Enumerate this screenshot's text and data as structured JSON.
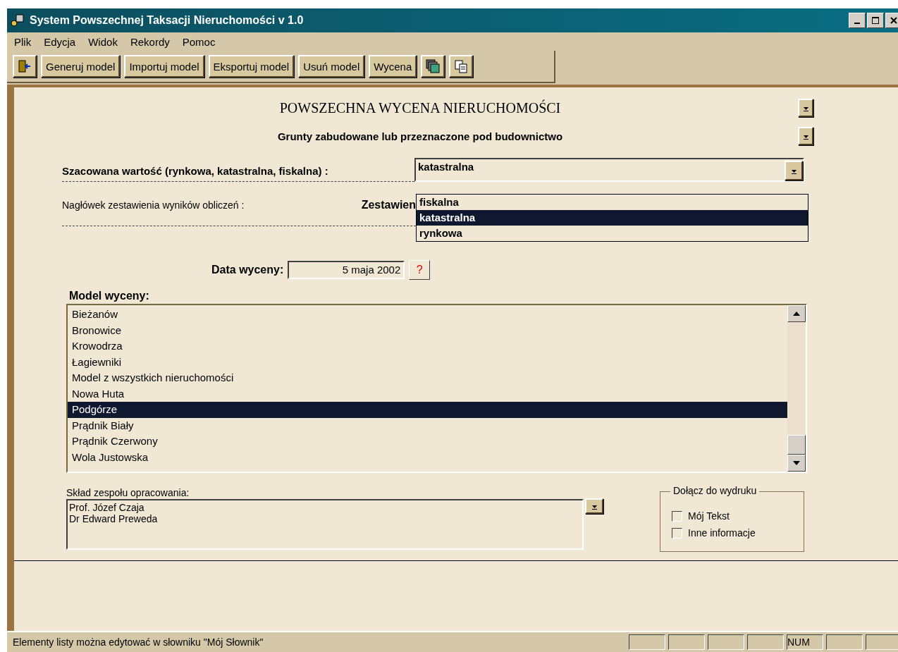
{
  "window": {
    "title": "System Powszechnej Taksacji Nieruchomości  v 1.0"
  },
  "menu": [
    "Plik",
    "Edycja",
    "Widok",
    "Rekordy",
    "Pomoc"
  ],
  "toolbar": [
    {
      "kind": "exit"
    },
    {
      "kind": "text",
      "label": "Generuj model"
    },
    {
      "kind": "text",
      "label": "Importuj model"
    },
    {
      "kind": "text",
      "label": "Eksportuj model"
    },
    {
      "kind": "text",
      "label": "Usuń model"
    },
    {
      "kind": "text",
      "label": "Wycena"
    },
    {
      "kind": "pages"
    },
    {
      "kind": "copy"
    }
  ],
  "heading": "POWSZECHNA WYCENA NIERUCHOMOŚCI",
  "subheading": "Grunty zabudowane lub przeznaczone pod budownictwo",
  "value_type": {
    "label": "Szacowana wartość (rynkowa, katastralna, fiskalna) :",
    "value": "katastralna",
    "expanded": true,
    "options": [
      {
        "label": "fiskalna",
        "selected": false
      },
      {
        "label": "katastralna",
        "selected": true
      },
      {
        "label": "rynkowa",
        "selected": false
      }
    ]
  },
  "report_header": {
    "label": "Nagłówek zestawienia wyników obliczeń :",
    "value": "Zestawien"
  },
  "valuation_date": {
    "label": "Data wyceny:",
    "value": "5 maja 2002",
    "help": "?"
  },
  "model": {
    "label": "Model wyceny:",
    "items": [
      {
        "label": "Bieżanów",
        "selected": false
      },
      {
        "label": "Bronowice",
        "selected": false
      },
      {
        "label": "Krowodrza",
        "selected": false
      },
      {
        "label": "Łagiewniki",
        "selected": false
      },
      {
        "label": "Model z wszystkich nieruchomości",
        "selected": false
      },
      {
        "label": "Nowa Huta",
        "selected": false
      },
      {
        "label": "Podgórze",
        "selected": true
      },
      {
        "label": "Prądnik Biały",
        "selected": false
      },
      {
        "label": "Prądnik Czerwony",
        "selected": false
      },
      {
        "label": "Wola Justowska",
        "selected": false
      }
    ]
  },
  "team": {
    "label": "Skład zespołu opracowania:",
    "lines": [
      "Prof. Józef Czaja",
      "Dr Edward Preweda"
    ]
  },
  "print_options": {
    "title": "Dołącz do wydruku",
    "items": [
      {
        "label": "Mój Tekst",
        "checked": false
      },
      {
        "label": "Inne informacje",
        "checked": false
      }
    ]
  },
  "status_bar": {
    "message": "Elementy listy można edytować w słowniku \"Mój Słownik\"",
    "indicators": [
      "NUM"
    ]
  }
}
